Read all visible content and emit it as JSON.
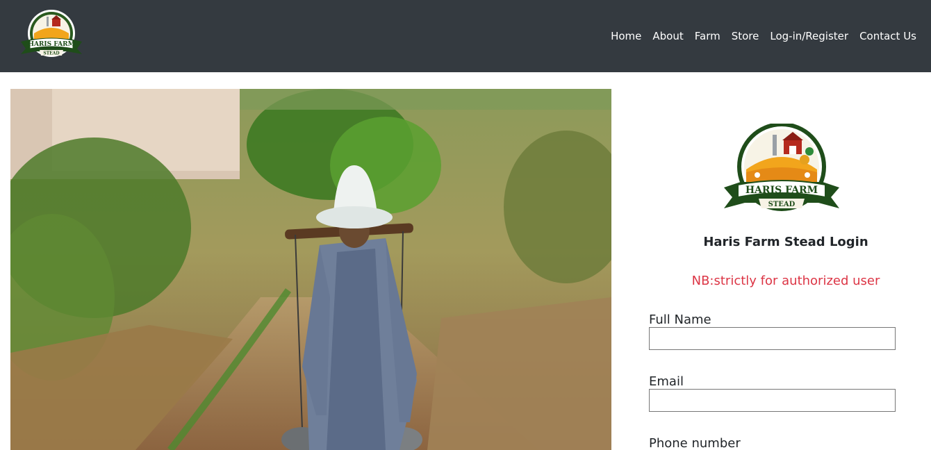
{
  "brand": {
    "logo_line1": "HARIS FARM",
    "logo_line2": "STEAD"
  },
  "nav": {
    "items": [
      {
        "label": "Home"
      },
      {
        "label": "About"
      },
      {
        "label": "Farm"
      },
      {
        "label": "Store"
      },
      {
        "label": "Log-in/Register"
      },
      {
        "label": "Contact Us"
      }
    ]
  },
  "login": {
    "title": "Haris Farm Stead Login",
    "note": "NB:strictly for authorized user",
    "fields": [
      {
        "label": "Full Name",
        "value": ""
      },
      {
        "label": "Email",
        "value": ""
      },
      {
        "label": "Phone number",
        "value": ""
      }
    ]
  },
  "colors": {
    "navbar_bg": "#343a40",
    "note_red": "#dc3545",
    "logo_green": "#1f4d1a",
    "logo_orange": "#f2a51c"
  },
  "icons": {
    "logo": "farm-badge-icon",
    "hero": "farmer-carrying-buckets-photo"
  }
}
